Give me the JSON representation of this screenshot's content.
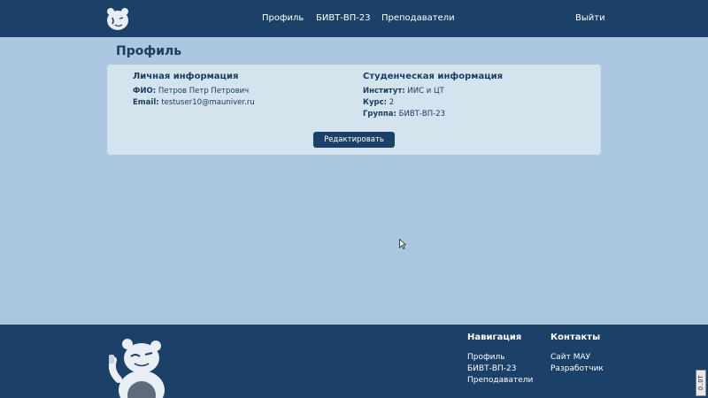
{
  "header": {
    "logo_icon": "bear-logo-icon",
    "nav": [
      "Профиль",
      "БИВТ-ВП-23",
      "Преподаватели"
    ],
    "logout": "Выйти"
  },
  "page": {
    "title": "Профиль"
  },
  "personal": {
    "title": "Личная информация",
    "fio_label": "ФИО:",
    "fio_value": "Петров Петр Петрович",
    "email_label": "Email:",
    "email_value": "testuser10@mauniver.ru"
  },
  "student": {
    "title": "Студенческая информация",
    "institute_label": "Институт:",
    "institute_value": "ИИС и ЦТ",
    "course_label": "Курс:",
    "course_value": "2",
    "group_label": "Группа:",
    "group_value": "БИВТ-ВП-23"
  },
  "edit_button": "Редактировать",
  "footer": {
    "mascot_icon": "bear-mascot-icon",
    "nav_title": "Навигация",
    "nav_links": [
      "Профиль",
      "БИВТ-ВП-23",
      "Преподаватели"
    ],
    "contacts_title": "Контакты",
    "contact_links": [
      "Сайт МАУ",
      "Разработчик"
    ]
  },
  "badge": "D.DT",
  "colors": {
    "header_bg": "#1c4168",
    "page_bg": "#abc7e0",
    "card_bg": "#d3e4ef",
    "text": "#1c3d60"
  }
}
